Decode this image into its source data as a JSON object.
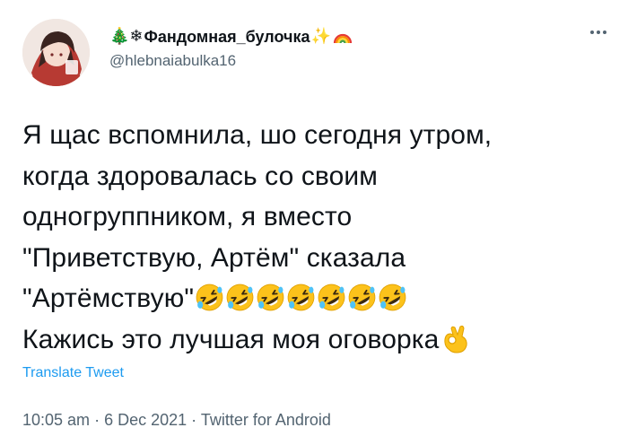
{
  "user": {
    "display_name": "Фандомная_булочка",
    "handle": "@hlebnaiabulka16",
    "prefix_emoji": "🎄❄",
    "suffix_emoji": "✨"
  },
  "tweet": {
    "lines": [
      "Я щас вспомнила, шо сегодня утром,",
      "когда здоровалась со своим",
      "одногруппником, я  вместо",
      "\"Приветствую, Артём\" сказала",
      "\"Артёмствую\"",
      "Кажись это лучшая моя оговорка"
    ],
    "laugh_emoji_count": 7
  },
  "translate_label": "Translate Tweet",
  "meta": {
    "time": "10:05 am",
    "separator": " · ",
    "date": "6 Dec 2021",
    "source": "Twitter for Android"
  },
  "icons": {
    "more": "more-icon",
    "laugh": "rolling-laughing-emoji",
    "ok": "ok-hand-emoji",
    "rainbow": "rainbow-emoji"
  },
  "colors": {
    "text": "#0f1419",
    "secondary": "#536471",
    "link": "#1d9bf0",
    "emoji_yellow": "#fbc02d"
  }
}
